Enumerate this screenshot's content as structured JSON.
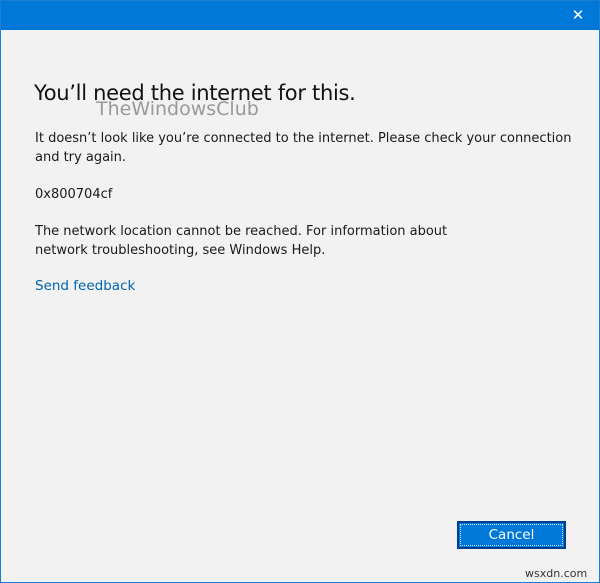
{
  "dialog": {
    "close_icon": "close-icon",
    "heading": "You’ll need the internet for this.",
    "message": "It doesn’t look like you’re connected to the internet. Please check your connection and try again.",
    "error_code": "0x800704cf",
    "detail": "The network location cannot be reached. For information about network troubleshooting, see Windows Help.",
    "feedback_link": "Send feedback",
    "cancel_label": "Cancel",
    "accent_color": "#0078d7"
  },
  "watermarks": {
    "top": "TheWindowsClub",
    "bottom": "wsxdn.com"
  }
}
